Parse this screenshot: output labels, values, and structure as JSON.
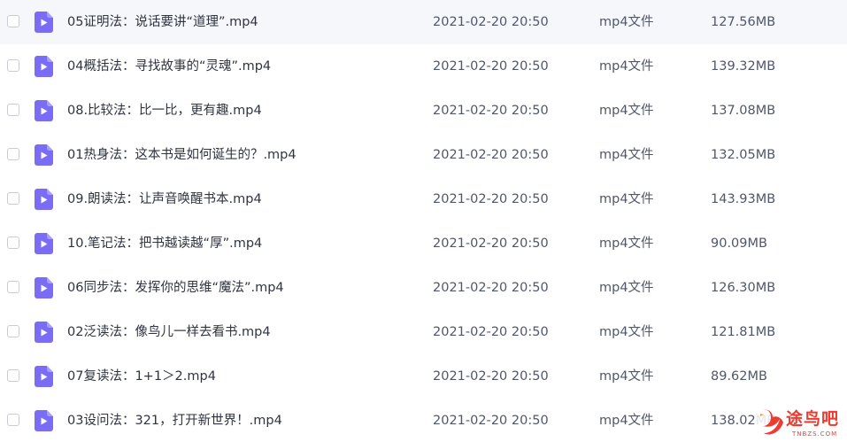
{
  "icon": {
    "name": "video-file-icon",
    "color": "#7b6cf6",
    "play_color": "#ffffff"
  },
  "files": [
    {
      "name": "05证明法：说话要讲“道理”.mp4",
      "date": "2021-02-20 20:50",
      "type": "mp4文件",
      "size": "127.56MB"
    },
    {
      "name": "04概括法：寻找故事的“灵魂”.mp4",
      "date": "2021-02-20 20:50",
      "type": "mp4文件",
      "size": "139.32MB"
    },
    {
      "name": "08.比较法：比一比，更有趣.mp4",
      "date": "2021-02-20 20:50",
      "type": "mp4文件",
      "size": "137.08MB"
    },
    {
      "name": "01热身法：这本书是如何诞生的？.mp4",
      "date": "2021-02-20 20:50",
      "type": "mp4文件",
      "size": "132.05MB"
    },
    {
      "name": "09.朗读法：让声音唤醒书本.mp4",
      "date": "2021-02-20 20:50",
      "type": "mp4文件",
      "size": "143.93MB"
    },
    {
      "name": "10.笔记法：把书越读越“厚”.mp4",
      "date": "2021-02-20 20:50",
      "type": "mp4文件",
      "size": "90.09MB"
    },
    {
      "name": "06同步法：发挥你的思维“魔法”.mp4",
      "date": "2021-02-20 20:50",
      "type": "mp4文件",
      "size": "126.30MB"
    },
    {
      "name": "02泛读法：像鸟儿一样去看书.mp4",
      "date": "2021-02-20 20:50",
      "type": "mp4文件",
      "size": "121.81MB"
    },
    {
      "name": "07复读法：1+1＞2.mp4",
      "date": "2021-02-20 20:50",
      "type": "mp4文件",
      "size": "89.62MB"
    },
    {
      "name": "03设问法：321，打开新世界！.mp4",
      "date": "2021-02-20 20:50",
      "type": "mp4文件",
      "size": "138.02MB"
    }
  ],
  "watermark": {
    "text": "途鸟吧",
    "sub": "TNBZS.COM",
    "color": "#ef3a30"
  }
}
